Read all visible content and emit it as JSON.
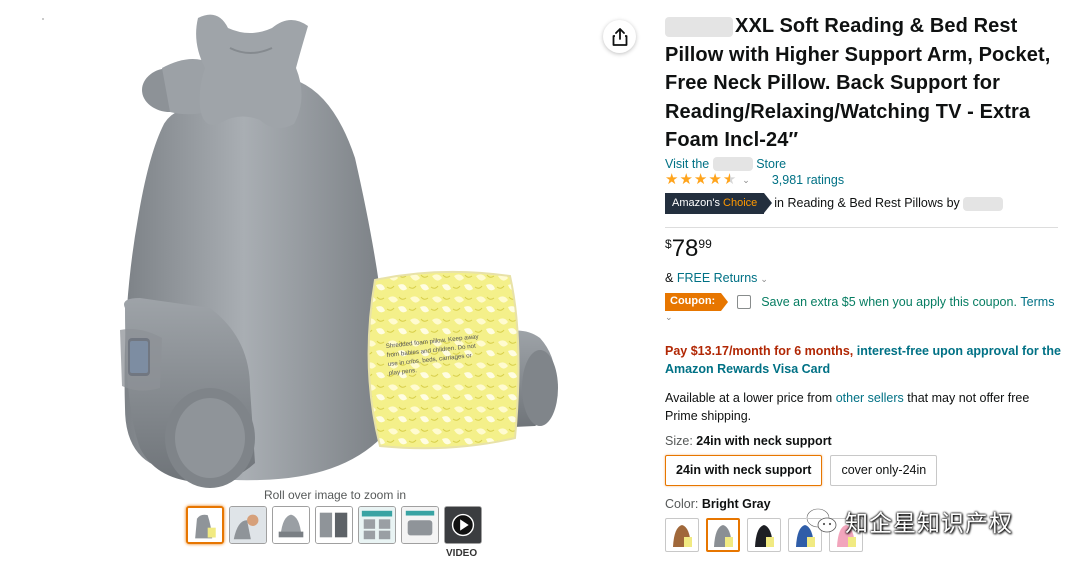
{
  "product": {
    "title": "XXL Soft Reading & Bed Rest Pillow with Higher Support Arm, Pocket, Free Neck Pillow. Back Support for Reading/Relaxing/Watching TV - Extra Foam Incl-24″",
    "store_prefix": "Visit the",
    "store_suffix": "Store",
    "rating_count": "3,981 ratings",
    "stars": 4.5
  },
  "badge": {
    "amazon": "Amazon's",
    "choice": "Choice",
    "category": "in Reading & Bed Rest Pillows by"
  },
  "price": {
    "symbol": "$",
    "whole": "78",
    "fraction": "99"
  },
  "returns": {
    "prefix": "&",
    "link": "FREE Returns"
  },
  "coupon": {
    "badge": "Coupon:",
    "text": "Save an extra $5 when you apply this coupon.",
    "terms": "Terms"
  },
  "financing": {
    "price": "Pay $13.17/month for 6 months,",
    "rest": "interest-free upon approval for the Amazon Rewards Visa Card"
  },
  "lower_price": {
    "before": "Available at a lower price from",
    "link": "other sellers",
    "after": "that may not offer free Prime shipping."
  },
  "size": {
    "label": "Size:",
    "selected": "24in with neck support",
    "options": [
      "24in with neck support",
      "cover only-24in"
    ]
  },
  "color": {
    "label": "Color:",
    "selected": "Bright Gray",
    "swatches": [
      "#a0683a",
      "#8a8f94",
      "#1d1f24",
      "#2f5da8",
      "#f2a5bc"
    ]
  },
  "gallery": {
    "zoom_hint": "Roll over image to zoom in",
    "video_label": "VIDEO",
    "thumbnail_count": 7
  },
  "pillow_tag_text": "Shredded foam pillow. Keep away from babies and children. Do not use in cribs, beds, carriages or play pens.",
  "watermark": "知企星知识产权",
  "colors": {
    "link": "#007185",
    "accent": "#e77600",
    "price_red": "#b12704",
    "coupon_green": "#067d62",
    "badge_dark": "#232f3e",
    "star": "#ffa41c"
  }
}
